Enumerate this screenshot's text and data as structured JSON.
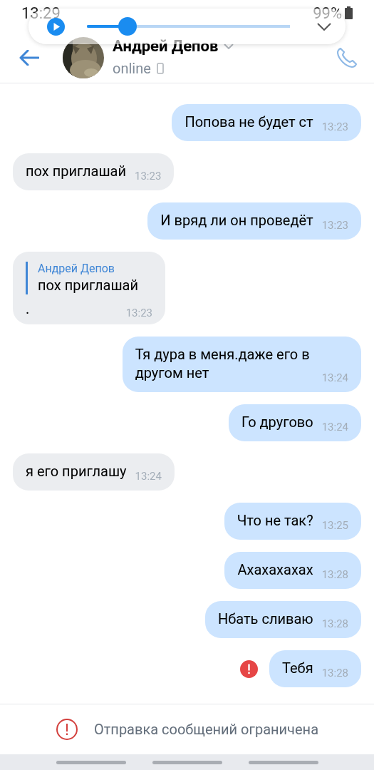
{
  "status_bar": {
    "time": "13:29",
    "battery": "99%"
  },
  "player": {
    "level": 0.2
  },
  "header": {
    "name": "Андрей Депов",
    "presence": "online"
  },
  "messages": [
    {
      "kind": "outgoing",
      "text": "Попова не будет ст",
      "time": "13:23",
      "failed": false
    },
    {
      "kind": "incoming",
      "text": "пох приглашай",
      "time": "13:23",
      "failed": false
    },
    {
      "kind": "outgoing",
      "text": "И вряд ли он проведёт",
      "time": "13:23",
      "failed": false
    },
    {
      "kind": "incoming",
      "reply": {
        "author": "Андрей Депов",
        "text": "пох приглашай"
      },
      "text": ".",
      "time": "13:23",
      "failed": false
    },
    {
      "kind": "outgoing",
      "text": "Тя дура в меня.даже его в другом нет",
      "time": "13:24",
      "failed": false
    },
    {
      "kind": "outgoing",
      "text": "Го другово",
      "time": "13:24",
      "failed": false
    },
    {
      "kind": "incoming",
      "text": "я его приглашу",
      "time": "13:24",
      "failed": false
    },
    {
      "kind": "outgoing",
      "text": "Что не так?",
      "time": "13:25",
      "failed": false
    },
    {
      "kind": "outgoing",
      "text": "Ахахахахах",
      "time": "13:28",
      "failed": false
    },
    {
      "kind": "outgoing",
      "text": "Нбать сливаю",
      "time": "13:28",
      "failed": false
    },
    {
      "kind": "outgoing",
      "text": "Тебя",
      "time": "13:28",
      "failed": true
    }
  ],
  "footer": {
    "notice": "Отправка сообщений ограничена"
  }
}
